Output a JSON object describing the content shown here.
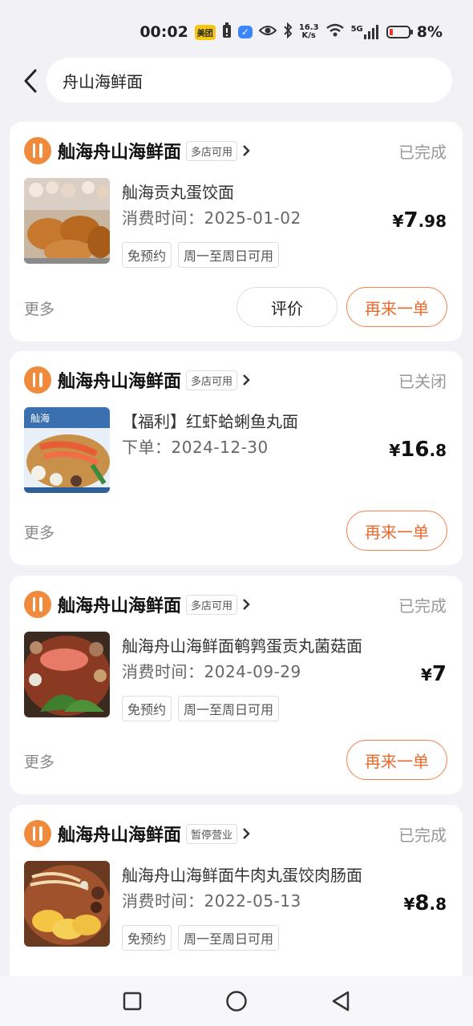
{
  "status_bar": {
    "time": "00:02",
    "app_badge": "美团",
    "net_speed_top": "16.3",
    "net_speed_bottom": "K/s",
    "network": "5G",
    "battery": "8%",
    "battery_level": 0.08
  },
  "header": {
    "search_value": "舟山海鲜面"
  },
  "orders": [
    {
      "shop_name": "舢海舟山海鲜面",
      "shop_tag": "多店可用",
      "status": "已完成",
      "item_title": "舢海贡丸蛋饺面",
      "date_text": "消费时间：2025-01-02",
      "tags": [
        "免预约",
        "周一至周日可用"
      ],
      "price_currency": "¥",
      "price_int": "7",
      "price_dec": ".98",
      "more_label": "更多",
      "review_label": "评价",
      "reorder_label": "再来一单"
    },
    {
      "shop_name": "舢海舟山海鲜面",
      "shop_tag": "多店可用",
      "status": "已关闭",
      "item_title": "【福利】红虾蛤蜊鱼丸面",
      "date_text": "下单：2024-12-30",
      "tags": [],
      "price_currency": "¥",
      "price_int": "16",
      "price_dec": ".8",
      "more_label": "更多",
      "reorder_label": "再来一单",
      "thumb_logo": "舢海"
    },
    {
      "shop_name": "舢海舟山海鲜面",
      "shop_tag": "多店可用",
      "status": "已完成",
      "item_title": "舢海舟山海鲜面鹌鹑蛋贡丸菌菇面",
      "date_text": "消费时间：2024-09-29",
      "tags": [
        "免预约",
        "周一至周日可用"
      ],
      "price_currency": "¥",
      "price_int": "7",
      "price_dec": "",
      "more_label": "更多",
      "reorder_label": "再来一单"
    },
    {
      "shop_name": "舢海舟山海鲜面",
      "shop_tag": "暂停营业",
      "status": "已完成",
      "item_title": "舢海舟山海鲜面牛肉丸蛋饺肉肠面",
      "date_text": "消费时间：2022-05-13",
      "tags": [
        "免预约",
        "周一至周日可用"
      ],
      "price_currency": "¥",
      "price_int": "8",
      "price_dec": ".8"
    }
  ],
  "colors": {
    "accent": "#ea6a2e",
    "shop_icon": "#f08a3c",
    "background": "#f2f2f6"
  },
  "icons": {
    "back": "chevron-left-icon",
    "shop": "fork-spoon-icon",
    "nav_recent": "square-icon",
    "nav_home": "circle-icon",
    "nav_back": "triangle-back-icon"
  }
}
